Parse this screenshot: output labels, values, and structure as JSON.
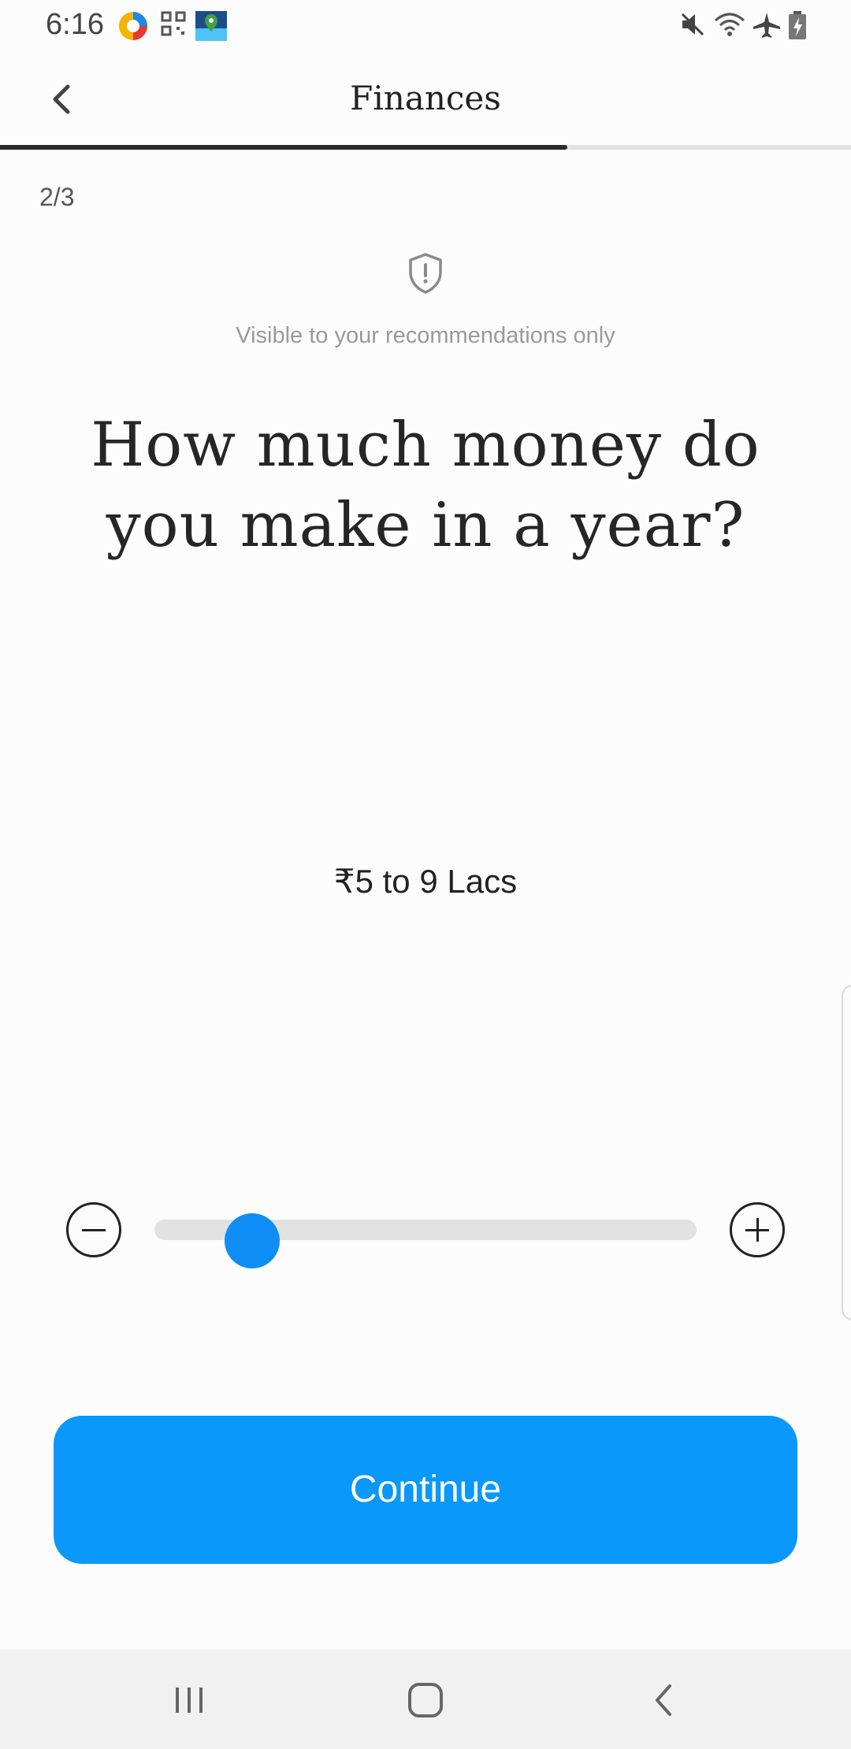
{
  "status_bar": {
    "time": "6:16",
    "left_icons": [
      "browser-app-icon",
      "qr-scanner-icon",
      "maps-app-icon"
    ],
    "right_icons": [
      "mute-icon",
      "wifi-icon",
      "airplane-mode-icon",
      "battery-charging-icon"
    ]
  },
  "header": {
    "title": "Finances",
    "back_icon": "chevron-left-icon",
    "progress": 0.667
  },
  "step": "2/3",
  "privacy": {
    "icon": "shield-alert-icon",
    "note": "Visible to your recommendations only"
  },
  "question": "How much money do you make in a year?",
  "income": {
    "selected_label": "₹5 to 9 Lacs",
    "slider_fraction": 0.18,
    "decrease_icon": "minus-circle-icon",
    "increase_icon": "plus-circle-icon"
  },
  "continue_label": "Continue",
  "colors": {
    "accent": "#0a98fb",
    "slider_thumb": "#0e8ef5",
    "track": "#e2e2e2",
    "progress_fill": "#2b2b2b"
  },
  "nav_bar": {
    "icons": [
      "recent-apps-icon",
      "home-icon",
      "back-icon"
    ]
  }
}
